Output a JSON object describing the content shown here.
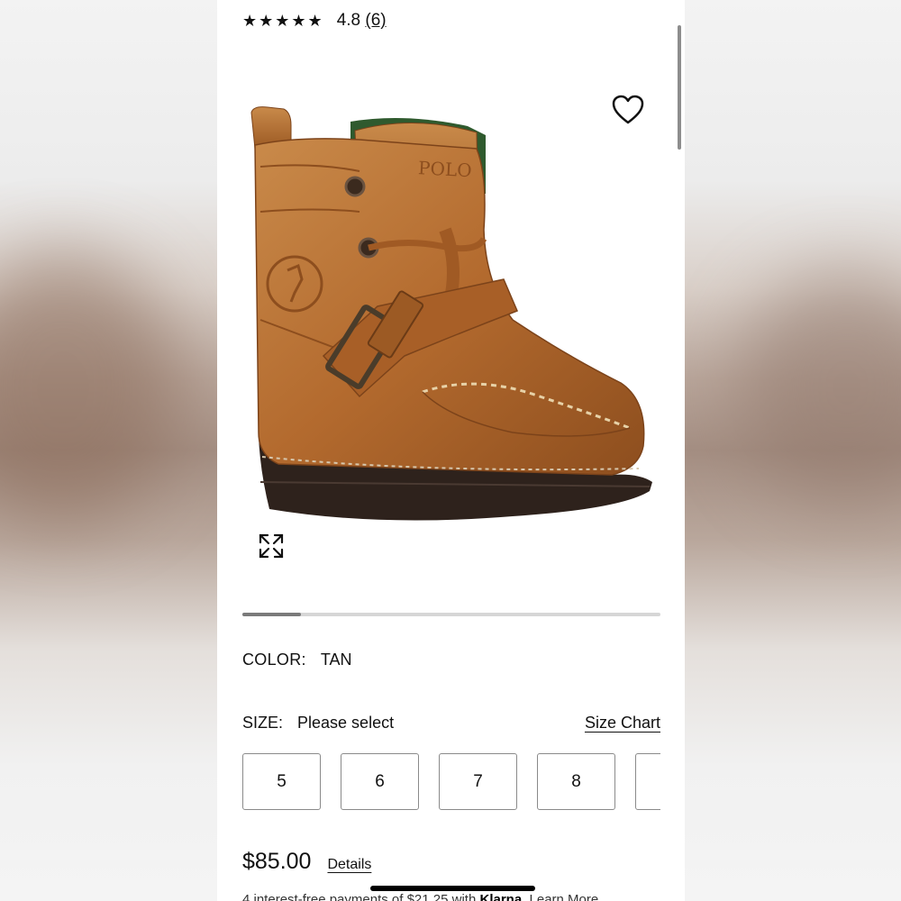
{
  "rating": {
    "stars": "★★★★★",
    "value": "4.8",
    "count": "(6)"
  },
  "product_image": {
    "alt": "Tan leather boot with buckle strap",
    "brand_emboss": "POLO"
  },
  "icons": {
    "favorite": "heart-icon",
    "expand": "expand-icon"
  },
  "carousel": {
    "progress_fraction": 0.14
  },
  "color": {
    "label": "COLOR:",
    "value": "TAN"
  },
  "size": {
    "label": "SIZE:",
    "value": "Please select",
    "chart_link": "Size Chart",
    "options": [
      "5",
      "6",
      "7",
      "8",
      ""
    ]
  },
  "price": {
    "amount": "$85.00",
    "details_link": "Details"
  },
  "installments": {
    "prefix": "4 interest-free payments of $21.25 with",
    "provider": "Klarna",
    "suffix": "Learn More"
  },
  "colors": {
    "leather": "#b36a2e",
    "sole": "#2e221c",
    "text": "#111111"
  }
}
